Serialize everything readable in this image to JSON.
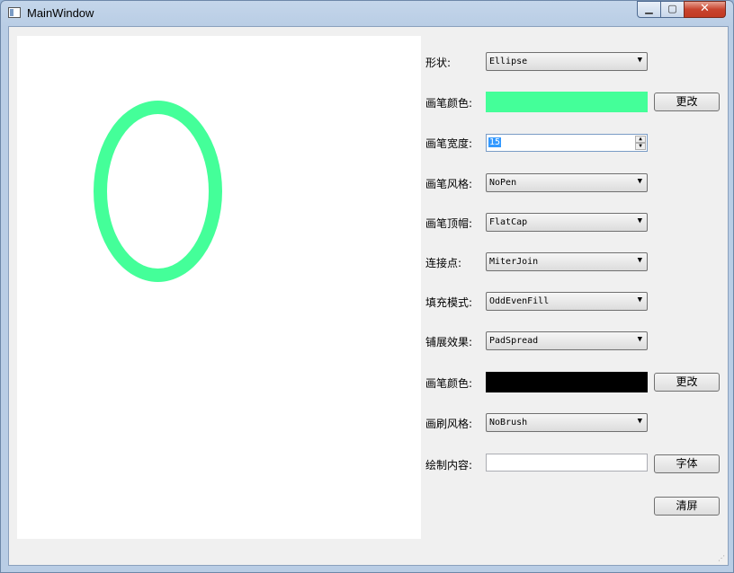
{
  "window": {
    "title": "MainWindow",
    "close_glyph": "✕",
    "minimize_glyph": "▁",
    "maximize_glyph": "▢"
  },
  "canvas": {
    "shape": "ellipse",
    "pen_color": "#44ff99"
  },
  "form": {
    "shape": {
      "label": "形状:",
      "value": "Ellipse"
    },
    "pen_color": {
      "label": "画笔颜色:",
      "color": "#44ff99",
      "button": "更改"
    },
    "pen_width": {
      "label": "画笔宽度:",
      "value": "15"
    },
    "pen_style": {
      "label": "画笔风格:",
      "value": "NoPen"
    },
    "pen_cap": {
      "label": "画笔顶帽:",
      "value": "FlatCap"
    },
    "join": {
      "label": "连接点:",
      "value": "MiterJoin"
    },
    "fill_mode": {
      "label": "填充模式:",
      "value": "OddEvenFill"
    },
    "spread": {
      "label": "铺展效果:",
      "value": "PadSpread"
    },
    "brush_color": {
      "label": "画笔颜色:",
      "color": "#000000",
      "button": "更改"
    },
    "brush_style": {
      "label": "画刷风格:",
      "value": "NoBrush"
    },
    "text": {
      "label": "绘制内容:",
      "value": "",
      "button": "字体"
    },
    "clear_button": "清屏"
  }
}
